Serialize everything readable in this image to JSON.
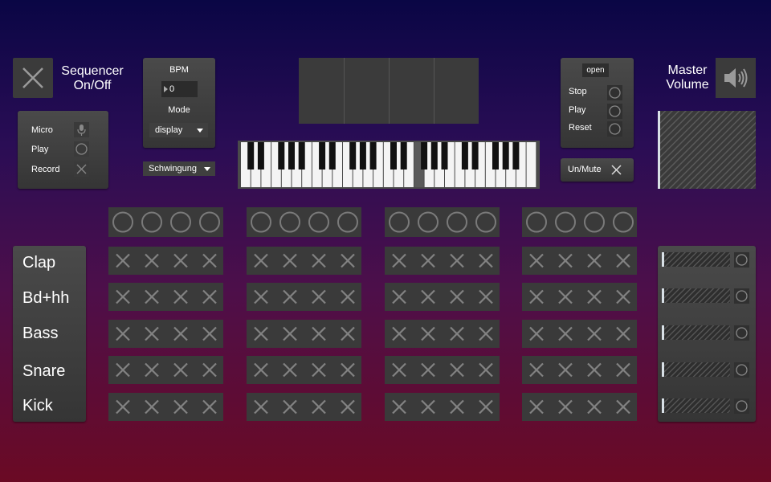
{
  "sequencer": {
    "label_line1": "Sequencer",
    "label_line2": "On/Off",
    "toggle_icon": "close-x-icon"
  },
  "input": {
    "items": [
      {
        "label": "Micro",
        "icon": "microphone-icon"
      },
      {
        "label": "Play",
        "icon": "circle-icon"
      },
      {
        "label": "Record",
        "icon": "close-x-icon"
      }
    ]
  },
  "bpm": {
    "label": "BPM",
    "value": "0",
    "mode_label": "Mode",
    "mode_value": "display"
  },
  "waveform": {
    "value": "Schwingung"
  },
  "transport": {
    "open_label": "open",
    "items": [
      {
        "label": "Stop"
      },
      {
        "label": "Play"
      },
      {
        "label": "Reset"
      }
    ],
    "unmute_label": "Un/Mute"
  },
  "master": {
    "label_line1": "Master",
    "label_line2": "Volume",
    "icon": "speaker-icon"
  },
  "instruments": [
    {
      "name": "Clap"
    },
    {
      "name": "Bd+hh"
    },
    {
      "name": "Bass"
    },
    {
      "name": "Snare"
    },
    {
      "name": "Kick"
    }
  ],
  "colors": {
    "panel": "#3a3a3a",
    "background_top": "#0a0645",
    "background_bottom": "#6b0a24"
  }
}
